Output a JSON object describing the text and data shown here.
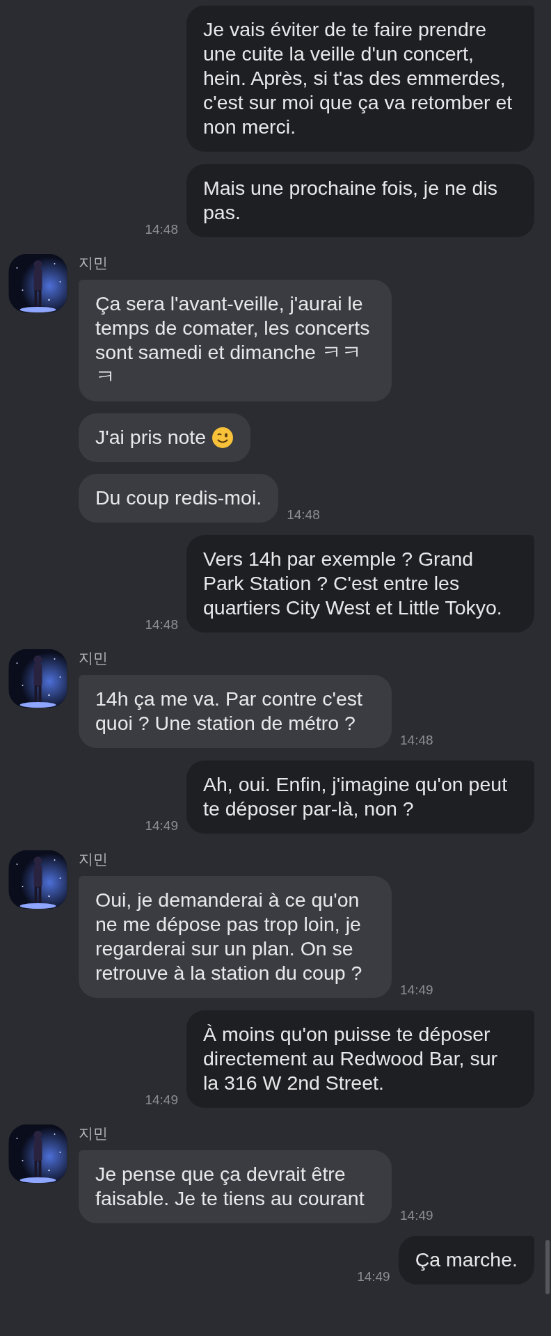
{
  "messages": [
    {
      "kind": "sent",
      "bubbles": [
        {
          "text": "Je vais éviter de te faire prendre une cuite la veille d'un concert, hein. Après, si t'as des emmerdes, c'est sur moi que ça va retomber et non merci."
        },
        {
          "text": "Mais une prochaine fois, je ne dis pas.",
          "time": "14:48"
        }
      ]
    },
    {
      "kind": "received",
      "sender": "지민",
      "bubbles": [
        {
          "text": "Ça sera l'avant-veille, j'aurai le temps de comater, les concerts sont samedi et dimanche ㅋㅋㅋ"
        },
        {
          "text": "J'ai pris note",
          "kind": "with_emoji"
        },
        {
          "text": "Du coup redis-moi.",
          "time": "14:48"
        }
      ]
    },
    {
      "kind": "sent",
      "bubbles": [
        {
          "text": "Vers 14h par exemple ? Grand Park Station ? C'est entre les quartiers City West  et Little Tokyo.",
          "time": "14:48"
        }
      ]
    },
    {
      "kind": "received",
      "sender": "지민",
      "bubbles": [
        {
          "text": "14h ça me va. Par contre c'est quoi ? Une station de métro ?",
          "time": "14:48"
        }
      ]
    },
    {
      "kind": "sent",
      "bubbles": [
        {
          "text": "Ah, oui. Enfin, j'imagine qu'on peut te déposer par-là, non ?",
          "time": "14:49"
        }
      ]
    },
    {
      "kind": "received",
      "sender": "지민",
      "bubbles": [
        {
          "text": "Oui, je demanderai à ce qu'on ne me dépose pas trop loin, je regarderai sur un plan. On se retrouve à la station du coup ?",
          "time": "14:49"
        }
      ]
    },
    {
      "kind": "sent",
      "bubbles": [
        {
          "text": "À moins qu'on puisse te déposer directement au Redwood Bar, sur la 316 W 2nd Street.",
          "time": "14:49"
        }
      ]
    },
    {
      "kind": "received",
      "sender": "지민",
      "bubbles": [
        {
          "text": "Je pense que ça devrait être faisable. Je te tiens au courant",
          "time": "14:49"
        }
      ]
    },
    {
      "kind": "sent",
      "bubbles": [
        {
          "text": "Ça marche.",
          "time": "14:49"
        }
      ]
    }
  ]
}
